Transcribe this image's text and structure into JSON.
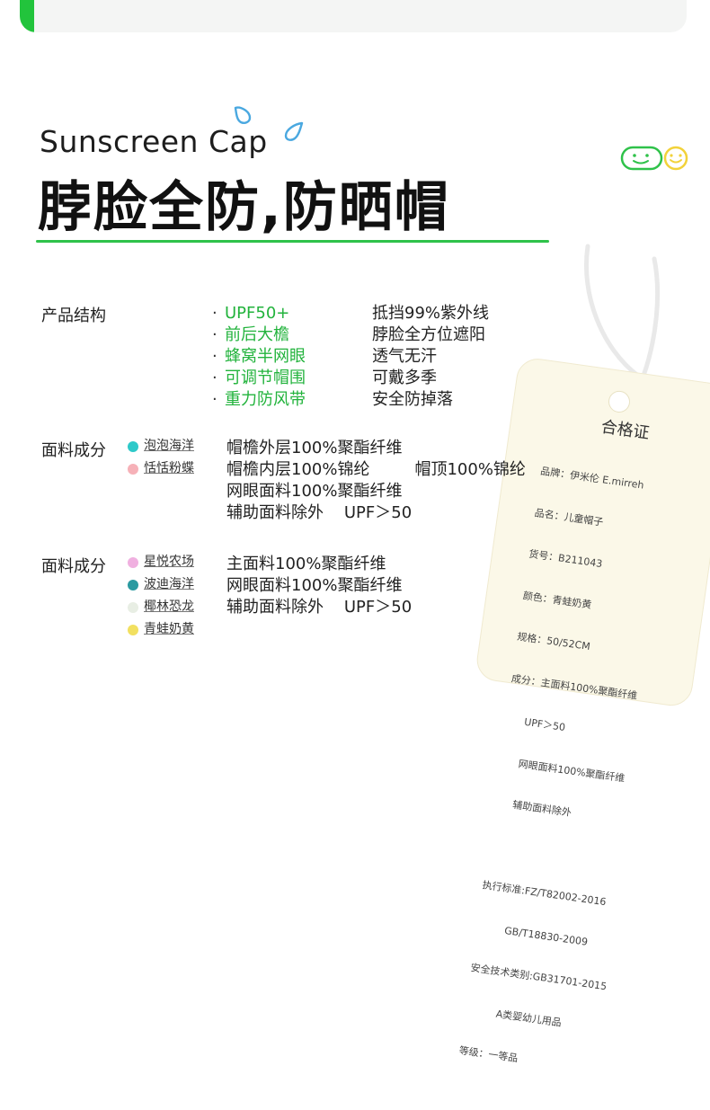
{
  "header": {
    "title_en": "Sunscreen Cap",
    "title_cn": "脖脸全防,防晒帽"
  },
  "colors": {
    "accent": "#22c43c",
    "highlight_text": "#22b33c",
    "mascot": "#2fc24a",
    "mascot_yellow": "#f2d23a",
    "drop": "#4aa8e0"
  },
  "structure": {
    "label": "产品结构",
    "items": [
      {
        "name": "UPF50+",
        "desc": "抵挡99%紫外线"
      },
      {
        "name": "前后大檐",
        "desc": "脖脸全方位遮阳"
      },
      {
        "name": "蜂窝半网眼",
        "desc": "透气无汗"
      },
      {
        "name": "可调节帽围",
        "desc": "可戴多季"
      },
      {
        "name": "重力防风带",
        "desc": "安全防掉落"
      }
    ],
    "bullet": "·"
  },
  "fabric1": {
    "label": "面料成分",
    "swatches": [
      {
        "name": "泡泡海洋",
        "color": "#2ec9c9"
      },
      {
        "name": "恬恬粉蝶",
        "color": "#f6b1b8"
      }
    ],
    "lines": [
      "帽檐外层100%聚酯纤维",
      "帽檐内层100%锦纶",
      "网眼面料100%聚酯纤维",
      "辅助面料除外    UPF＞50"
    ],
    "extra": "帽顶100%锦纶"
  },
  "fabric2": {
    "label": "面料成分",
    "swatches": [
      {
        "name": "星悦农场",
        "color": "#f0b0e0"
      },
      {
        "name": "波迪海洋",
        "color": "#2a9aa0"
      },
      {
        "name": "椰林恐龙",
        "color": "#e8eee4"
      },
      {
        "name": "青蛙奶黄",
        "color": "#f2e060"
      }
    ],
    "lines": [
      "主面料100%聚酯纤维",
      "网眼面料100%聚酯纤维",
      "辅助面料除外    UPF＞50"
    ]
  },
  "tag": {
    "title": "合格证",
    "lines": [
      "品牌：伊米伦 E.mirreh",
      "品名：儿童帽子",
      "货号：B211043",
      "颜色：青蛙奶黄",
      "规格：50/52CM",
      "成分：主面料100%聚酯纤维",
      "      UPF＞50",
      "      网眼面料100%聚酯纤维",
      "      辅助面料除外",
      "",
      "执行标准:FZ/T82002-2016",
      "         GB/T18830-2009",
      "安全技术类别:GB31701-2015",
      "          A类婴幼儿用品",
      "等级：一等品"
    ]
  }
}
